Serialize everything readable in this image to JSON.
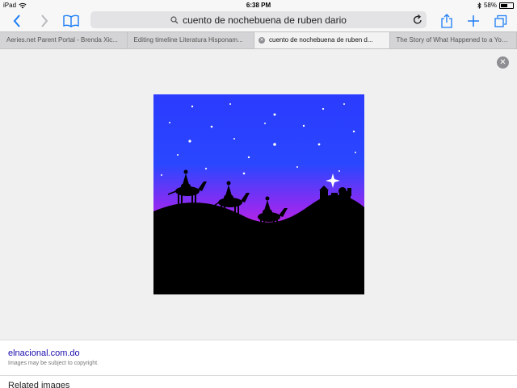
{
  "status_bar": {
    "device": "iPad",
    "time": "6:38 PM",
    "battery": "58%",
    "battery_level": 0.58
  },
  "toolbar": {
    "back_icon": "chevron-left-icon",
    "forward_icon": "chevron-right-icon",
    "bookmarks_icon": "book-icon",
    "share_icon": "share-icon",
    "add_icon": "plus-icon",
    "tabs_icon": "tabs-icon",
    "accent_color": "#1a7cf5"
  },
  "address_bar": {
    "query": "cuento de nochebuena de ruben dario"
  },
  "tabs": [
    {
      "title": "Aeries.net Parent Portal - Brenda Xic..."
    },
    {
      "title": "Editing timeline Literatura Hisponam..."
    },
    {
      "title": "cuento de nochebuena de ruben d..."
    },
    {
      "title": "The Story of What Happened to a You..."
    }
  ],
  "viewer": {
    "close_icon": "close-icon",
    "image_colors": {
      "sky_top": "#2b3bff",
      "sky_bottom": "#ff19d2",
      "ground": "#000000"
    }
  },
  "result": {
    "source": "elnacional.com.do",
    "notice": "Images may be subject to copyright."
  },
  "related": {
    "heading": "Related images"
  }
}
